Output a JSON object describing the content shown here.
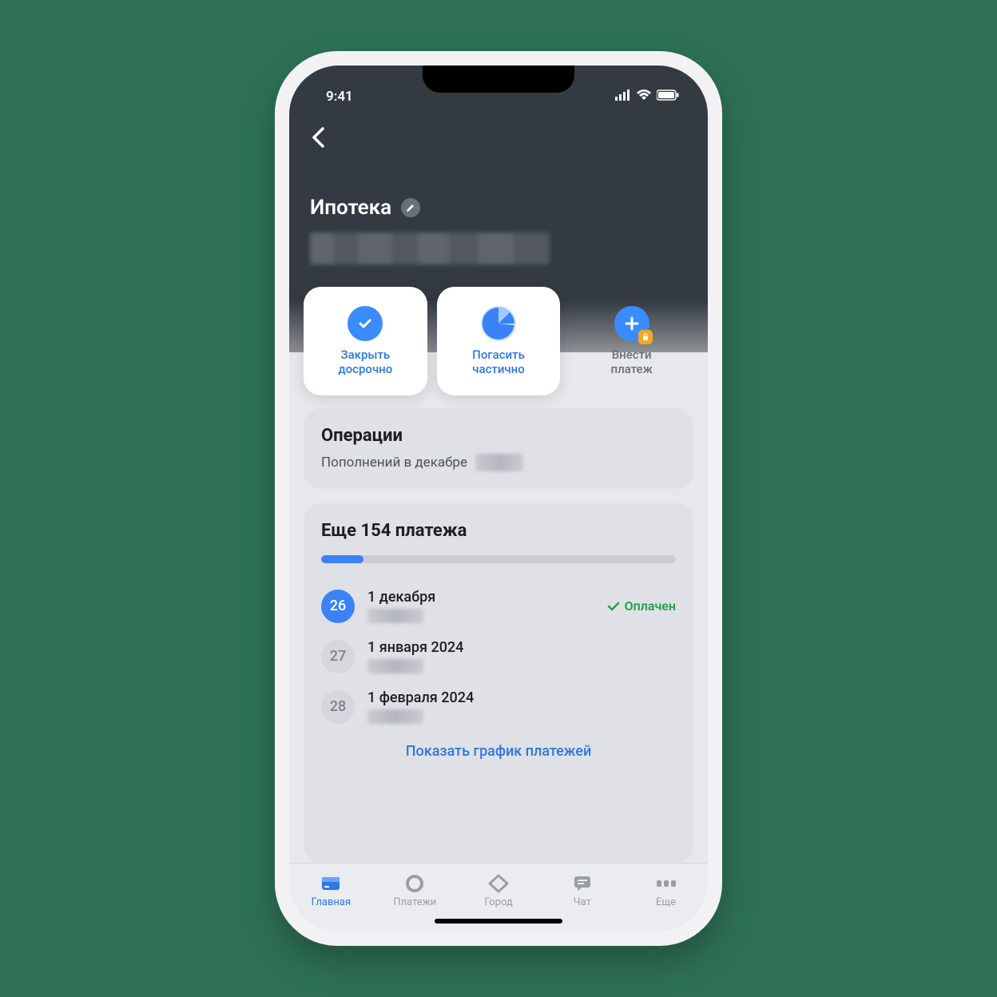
{
  "status": {
    "time": "9:41"
  },
  "header": {
    "title": "Ипотека"
  },
  "actions": [
    {
      "label": "Закрыть\nдосрочно",
      "icon": "check"
    },
    {
      "label": "Погасить\nчастично",
      "icon": "pie"
    },
    {
      "label": "Внести\nплатеж",
      "icon": "plus",
      "locked": true
    }
  ],
  "operations": {
    "title": "Операции",
    "subtitle": "Пополнений в декабре"
  },
  "schedule": {
    "title": "Еще 154 платежа",
    "progress_percent": 12,
    "rows": [
      {
        "day": "26",
        "date": "1 декабря",
        "status": "Оплачен",
        "active": true
      },
      {
        "day": "27",
        "date": "1 января 2024",
        "active": false
      },
      {
        "day": "28",
        "date": "1 февраля 2024",
        "active": false
      }
    ],
    "show_all": "Показать график платежей"
  },
  "tabs": [
    {
      "label": "Главная",
      "active": true
    },
    {
      "label": "Платежи"
    },
    {
      "label": "Город"
    },
    {
      "label": "Чат"
    },
    {
      "label": "Еще"
    }
  ]
}
